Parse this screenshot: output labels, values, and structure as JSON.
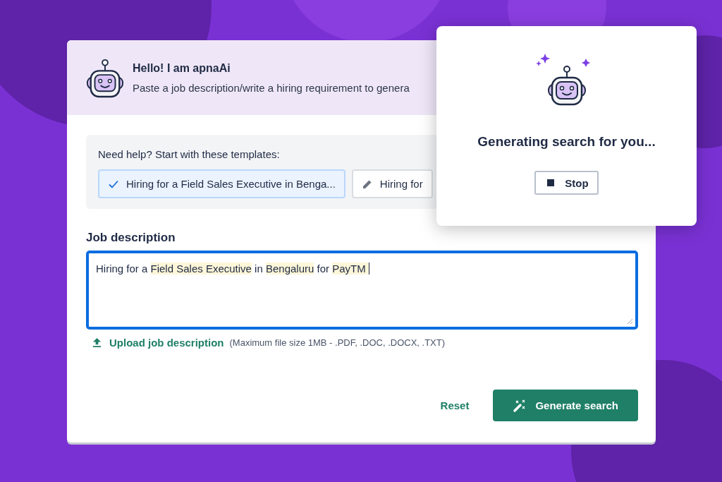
{
  "header": {
    "title": "Hello! I am apnaAi",
    "subtitle": "Paste a job description/write a hiring requirement to genera"
  },
  "templates": {
    "prompt": "Need help? Start with these templates:",
    "items": [
      {
        "label": "Hiring for a Field Sales Executive in Benga...",
        "selected": true
      },
      {
        "label": "Hiring for",
        "selected": false
      }
    ]
  },
  "job_description": {
    "label": "Job description",
    "segments": [
      {
        "text": "Hiring for a ",
        "highlight": false
      },
      {
        "text": "Field Sales Executive",
        "highlight": true
      },
      {
        "text": " in ",
        "highlight": false
      },
      {
        "text": "Bengaluru",
        "highlight": true
      },
      {
        "text": " for ",
        "highlight": false
      },
      {
        "text": "PayTM ",
        "highlight": true
      }
    ]
  },
  "upload": {
    "link": "Upload job description",
    "hint": "(Maximum file size 1MB - .PDF, .DOC, .DOCX, .TXT)"
  },
  "actions": {
    "reset": "Reset",
    "generate": "Generate search"
  },
  "popup": {
    "message": "Generating search for you...",
    "stop": "Stop"
  }
}
